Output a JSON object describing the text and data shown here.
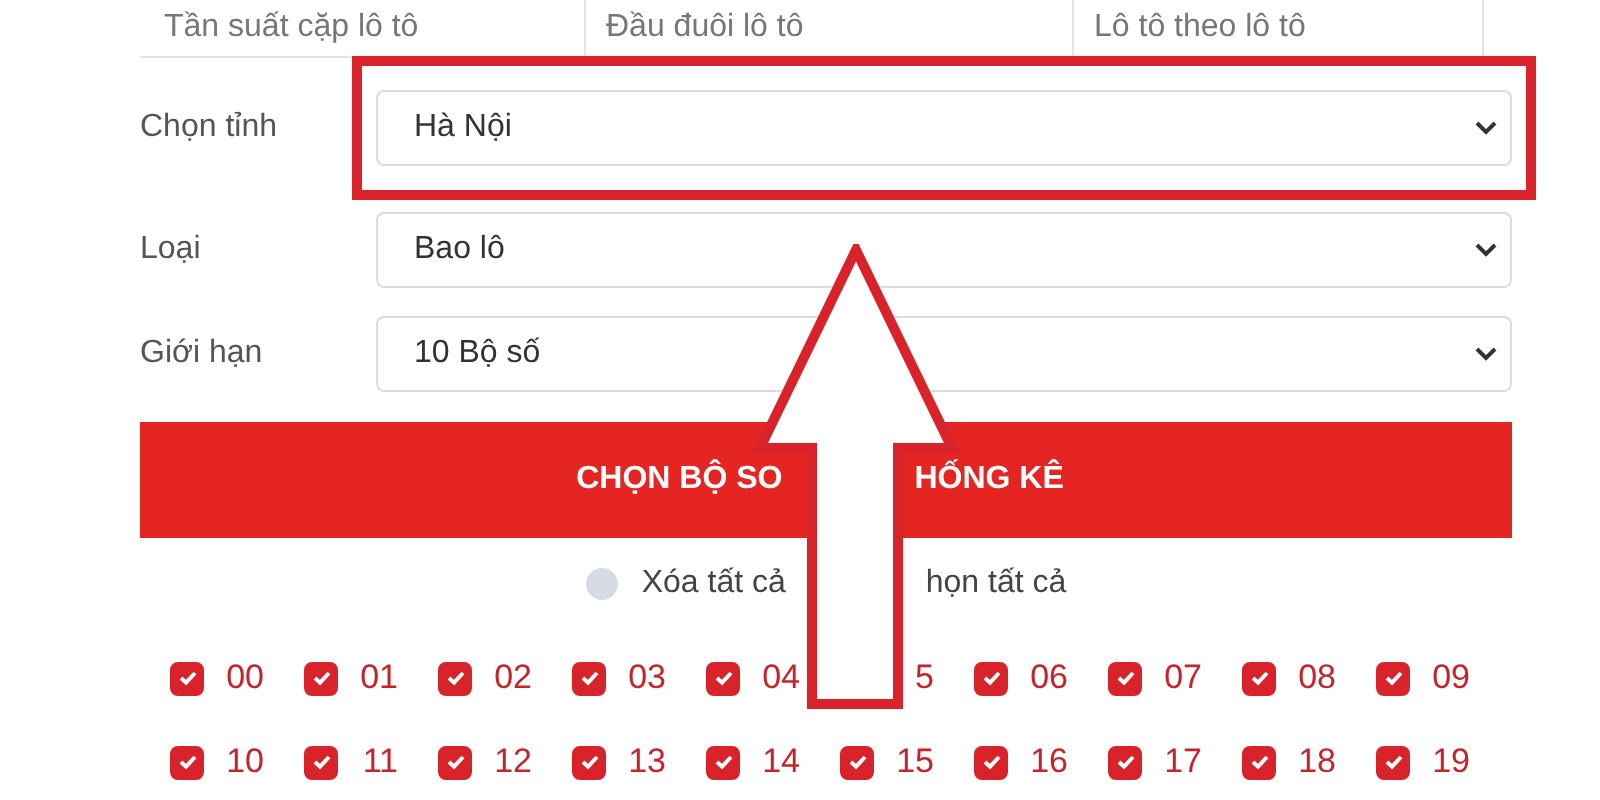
{
  "tabs": [
    {
      "label": "Tần suất cặp lô tô",
      "selected": false
    },
    {
      "label": "Đầu đuôi lô tô",
      "selected": false
    },
    {
      "label": "Lô tô theo lô tô",
      "selected": false
    }
  ],
  "fields": [
    {
      "label": "Chọn tỉnh",
      "value": "Hà Nội",
      "highlighted": true
    },
    {
      "label": "Loại",
      "value": "Bao lô"
    },
    {
      "label": "Giới hạn",
      "value": "10 Bộ số"
    }
  ],
  "submit_button": {
    "label_parts": [
      "CHỌN BỘ SO",
      "HỐNG KÊ"
    ]
  },
  "radio_options": [
    {
      "label": "Xóa tất cả",
      "selected": false
    },
    {
      "label": "họn tất cả"
    }
  ],
  "numbers": [
    {
      "label": "00",
      "checked": true
    },
    {
      "label": "01",
      "checked": true
    },
    {
      "label": "02",
      "checked": true
    },
    {
      "label": "03",
      "checked": true
    },
    {
      "label": "04",
      "checked": true
    },
    {
      "label": "5"
    },
    {
      "label": "06",
      "checked": true
    },
    {
      "label": "07",
      "checked": true
    },
    {
      "label": "08",
      "checked": true
    },
    {
      "label": "09",
      "checked": true
    },
    {
      "label": "10",
      "checked": true
    },
    {
      "label": "11",
      "checked": true
    },
    {
      "label": "12",
      "checked": true
    },
    {
      "label": "13",
      "checked": true
    },
    {
      "label": "14",
      "checked": true
    },
    {
      "label": "15",
      "checked": true
    },
    {
      "label": "16",
      "checked": true
    },
    {
      "label": "17",
      "checked": true
    },
    {
      "label": "18",
      "checked": true
    },
    {
      "label": "19",
      "checked": true
    }
  ],
  "annotation": {
    "kind": "arrow"
  }
}
